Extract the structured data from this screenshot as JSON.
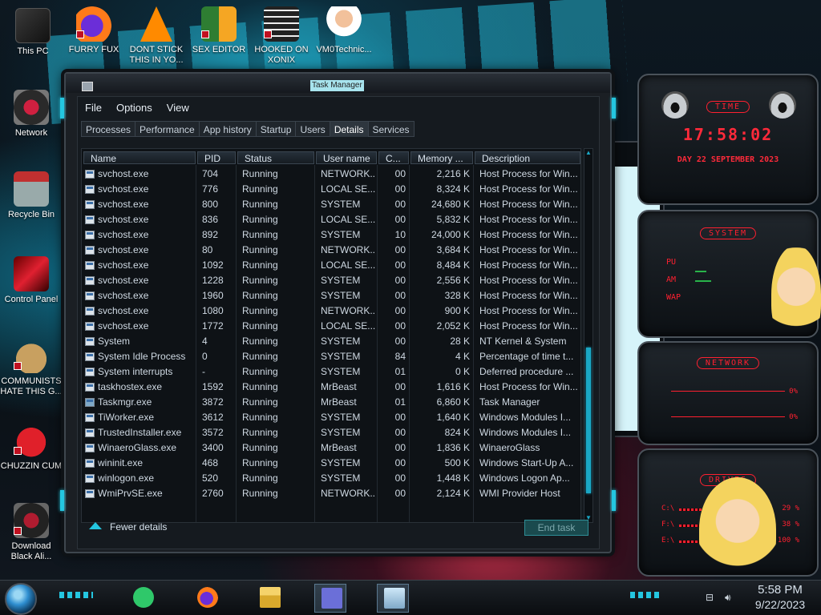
{
  "desktop": {
    "icons": [
      {
        "label": "This PC"
      },
      {
        "label": "FURRY FUX"
      },
      {
        "label": "DONT STICK THIS IN YO..."
      },
      {
        "label": "SEX EDITOR"
      },
      {
        "label": "HOOKED ON XONIX"
      },
      {
        "label": "VM0Technic..."
      },
      {
        "label": "Network"
      },
      {
        "label": "Recycle Bin"
      },
      {
        "label": "Control Panel"
      },
      {
        "label": "COMMUNISTS HATE THIS G..."
      },
      {
        "label": "CHUZZIN CUM"
      },
      {
        "label": "Download Black Ali..."
      }
    ]
  },
  "gadgets": {
    "clock": {
      "title": "TIME",
      "time": "17:58:02",
      "date": "DAY 22 SEPTEMBER 2023"
    },
    "system": {
      "title": "SYSTEM",
      "labels": [
        "PU",
        "AM",
        "WAP"
      ]
    },
    "network": {
      "title": "NETWORK",
      "in": "0%",
      "out": "0%"
    },
    "drives": {
      "title": "DRIVES",
      "rows": [
        {
          "label": "C:\\",
          "pct": "29 %"
        },
        {
          "label": "F:\\",
          "pct": "38 %"
        },
        {
          "label": "E:\\",
          "pct": "100 %"
        }
      ]
    }
  },
  "taskmanager": {
    "title": "Task Manager",
    "menu": [
      "File",
      "Options",
      "View"
    ],
    "tabs": [
      "Processes",
      "Performance",
      "App history",
      "Startup",
      "Users",
      "Details",
      "Services"
    ],
    "active_tab": "Details",
    "columns": [
      "Name",
      "PID",
      "Status",
      "User name",
      "C...",
      "Memory ...",
      "Description"
    ],
    "rows": [
      {
        "name": "svchost.exe",
        "pid": "704",
        "status": "Running",
        "user": "NETWORK...",
        "cpu": "00",
        "mem": "2,216 K",
        "desc": "Host Process for Win..."
      },
      {
        "name": "svchost.exe",
        "pid": "776",
        "status": "Running",
        "user": "LOCAL SE...",
        "cpu": "00",
        "mem": "8,324 K",
        "desc": "Host Process for Win..."
      },
      {
        "name": "svchost.exe",
        "pid": "800",
        "status": "Running",
        "user": "SYSTEM",
        "cpu": "00",
        "mem": "24,680 K",
        "desc": "Host Process for Win..."
      },
      {
        "name": "svchost.exe",
        "pid": "836",
        "status": "Running",
        "user": "LOCAL SE...",
        "cpu": "00",
        "mem": "5,832 K",
        "desc": "Host Process for Win..."
      },
      {
        "name": "svchost.exe",
        "pid": "892",
        "status": "Running",
        "user": "SYSTEM",
        "cpu": "10",
        "mem": "24,000 K",
        "desc": "Host Process for Win..."
      },
      {
        "name": "svchost.exe",
        "pid": "80",
        "status": "Running",
        "user": "NETWORK...",
        "cpu": "00",
        "mem": "3,684 K",
        "desc": "Host Process for Win..."
      },
      {
        "name": "svchost.exe",
        "pid": "1092",
        "status": "Running",
        "user": "LOCAL SE...",
        "cpu": "00",
        "mem": "8,484 K",
        "desc": "Host Process for Win..."
      },
      {
        "name": "svchost.exe",
        "pid": "1228",
        "status": "Running",
        "user": "SYSTEM",
        "cpu": "00",
        "mem": "2,556 K",
        "desc": "Host Process for Win..."
      },
      {
        "name": "svchost.exe",
        "pid": "1960",
        "status": "Running",
        "user": "SYSTEM",
        "cpu": "00",
        "mem": "328 K",
        "desc": "Host Process for Win..."
      },
      {
        "name": "svchost.exe",
        "pid": "1080",
        "status": "Running",
        "user": "NETWORK...",
        "cpu": "00",
        "mem": "900 K",
        "desc": "Host Process for Win..."
      },
      {
        "name": "svchost.exe",
        "pid": "1772",
        "status": "Running",
        "user": "LOCAL SE...",
        "cpu": "00",
        "mem": "2,052 K",
        "desc": "Host Process for Win..."
      },
      {
        "name": "System",
        "pid": "4",
        "status": "Running",
        "user": "SYSTEM",
        "cpu": "00",
        "mem": "28 K",
        "desc": "NT Kernel & System"
      },
      {
        "name": "System Idle Process",
        "pid": "0",
        "status": "Running",
        "user": "SYSTEM",
        "cpu": "84",
        "mem": "4 K",
        "desc": "Percentage of time t..."
      },
      {
        "name": "System interrupts",
        "pid": "-",
        "status": "Running",
        "user": "SYSTEM",
        "cpu": "01",
        "mem": "0 K",
        "desc": "Deferred procedure ..."
      },
      {
        "name": "taskhostex.exe",
        "pid": "1592",
        "status": "Running",
        "user": "MrBeast",
        "cpu": "00",
        "mem": "1,616 K",
        "desc": "Host Process for Win..."
      },
      {
        "name": "Taskmgr.exe",
        "pid": "3872",
        "status": "Running",
        "user": "MrBeast",
        "cpu": "01",
        "mem": "6,860 K",
        "desc": "Task Manager"
      },
      {
        "name": "TiWorker.exe",
        "pid": "3612",
        "status": "Running",
        "user": "SYSTEM",
        "cpu": "00",
        "mem": "1,640 K",
        "desc": "Windows Modules I..."
      },
      {
        "name": "TrustedInstaller.exe",
        "pid": "3572",
        "status": "Running",
        "user": "SYSTEM",
        "cpu": "00",
        "mem": "824 K",
        "desc": "Windows Modules I..."
      },
      {
        "name": "WinaeroGlass.exe",
        "pid": "3400",
        "status": "Running",
        "user": "MrBeast",
        "cpu": "00",
        "mem": "1,836 K",
        "desc": "WinaeroGlass"
      },
      {
        "name": "wininit.exe",
        "pid": "468",
        "status": "Running",
        "user": "SYSTEM",
        "cpu": "00",
        "mem": "500 K",
        "desc": "Windows Start-Up A..."
      },
      {
        "name": "winlogon.exe",
        "pid": "520",
        "status": "Running",
        "user": "SYSTEM",
        "cpu": "00",
        "mem": "1,448 K",
        "desc": "Windows Logon Ap..."
      },
      {
        "name": "WmiPrvSE.exe",
        "pid": "2760",
        "status": "Running",
        "user": "NETWORK...",
        "cpu": "00",
        "mem": "2,124 K",
        "desc": "WMI Provider Host"
      }
    ],
    "fewer_details": "Fewer details",
    "end_task": "End task"
  },
  "taskbar": {
    "time": "5:58 PM",
    "date": "9/22/2023"
  },
  "colors": {
    "accent": "#24c6e0",
    "gadget_red": "#ff2030"
  }
}
